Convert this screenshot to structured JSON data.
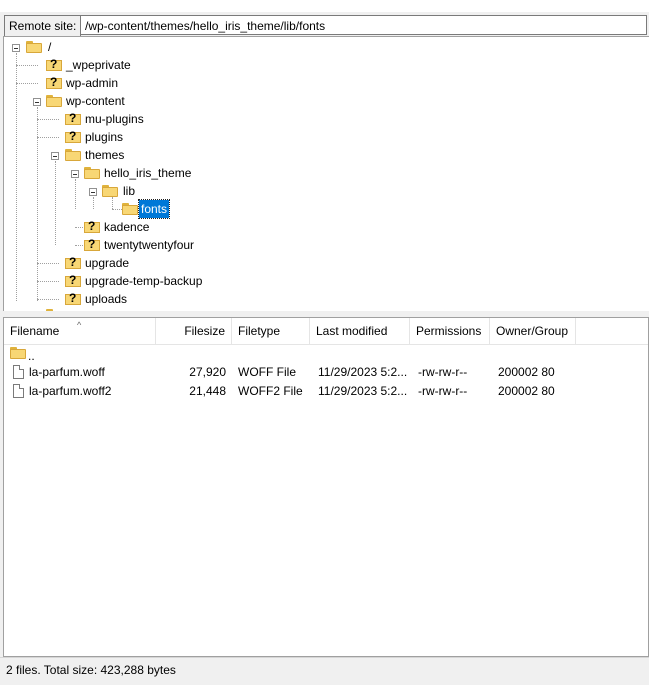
{
  "remote_site": {
    "label": "Remote site:",
    "path": "/wp-content/themes/hello_iris_theme/lib/fonts"
  },
  "tree": {
    "root": "/",
    "items": {
      "wpeprivate": "_wpeprivate",
      "wp_admin": "wp-admin",
      "wp_content": "wp-content",
      "mu_plugins": "mu-plugins",
      "plugins": "plugins",
      "themes": "themes",
      "hello_iris_theme": "hello_iris_theme",
      "lib": "lib",
      "fonts": "fonts",
      "kadence": "kadence",
      "twentytwentyfour": "twentytwentyfour",
      "upgrade": "upgrade",
      "upgrade_temp_backup": "upgrade-temp-backup",
      "uploads": "uploads"
    },
    "unknown_glyph": "?"
  },
  "file_list": {
    "columns": {
      "filename": "Filename",
      "filesize": "Filesize",
      "filetype": "Filetype",
      "last_modified": "Last modified",
      "permissions": "Permissions",
      "owner_group": "Owner/Group"
    },
    "sort_indicator": "^",
    "parent": "..",
    "rows": [
      {
        "filename": "la-parfum.woff",
        "filesize": "27,920",
        "filetype": "WOFF File",
        "last_modified": "11/29/2023 5:2...",
        "permissions": "-rw-rw-r--",
        "owner_group": "200002 80"
      },
      {
        "filename": "la-parfum.woff2",
        "filesize": "21,448",
        "filetype": "WOFF2 File",
        "last_modified": "11/29/2023 5:2...",
        "permissions": "-rw-rw-r--",
        "owner_group": "200002 80"
      }
    ]
  },
  "status_bar": {
    "text": "2 files. Total size: 423,288 bytes"
  }
}
